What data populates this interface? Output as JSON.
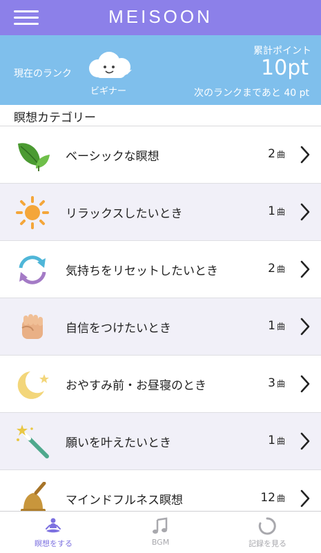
{
  "app": {
    "title": "MEISOON"
  },
  "rank": {
    "current_label": "現在のランク",
    "rank_name": "ビギナー",
    "points_label": "累計ポイント",
    "points_value": "10pt",
    "next_rank_text": "次のランクまであと 40 pt"
  },
  "categories": {
    "title": "瞑想カテゴリー",
    "items": [
      {
        "label": "ベーシックな瞑想",
        "count": "2",
        "unit": "曲",
        "icon": "leaf-icon"
      },
      {
        "label": "リラックスしたいとき",
        "count": "1",
        "unit": "曲",
        "icon": "sun-icon"
      },
      {
        "label": "気持ちをリセットしたいとき",
        "count": "2",
        "unit": "曲",
        "icon": "refresh-icon"
      },
      {
        "label": "自信をつけたいとき",
        "count": "1",
        "unit": "曲",
        "icon": "fist-icon"
      },
      {
        "label": "おやすみ前・お昼寝のとき",
        "count": "3",
        "unit": "曲",
        "icon": "moon-icon"
      },
      {
        "label": "願いを叶えたいとき",
        "count": "1",
        "unit": "曲",
        "icon": "magic-wand-icon"
      },
      {
        "label": "マインドフルネス瞑想",
        "count": "12",
        "unit": "曲",
        "icon": "bell-icon"
      }
    ]
  },
  "tabs": [
    {
      "label": "瞑想をする",
      "icon": "meditation-icon",
      "active": true
    },
    {
      "label": "BGM",
      "icon": "music-note-icon",
      "active": false
    },
    {
      "label": "記録を見る",
      "icon": "loading-ring-icon",
      "active": false
    }
  ],
  "colors": {
    "header": "#8c80e9",
    "rank_banner": "#7fbfec",
    "row_alt": "#f1f0f8",
    "active_tab": "#7c70e0",
    "inactive_tab": "#a8a8ad"
  }
}
